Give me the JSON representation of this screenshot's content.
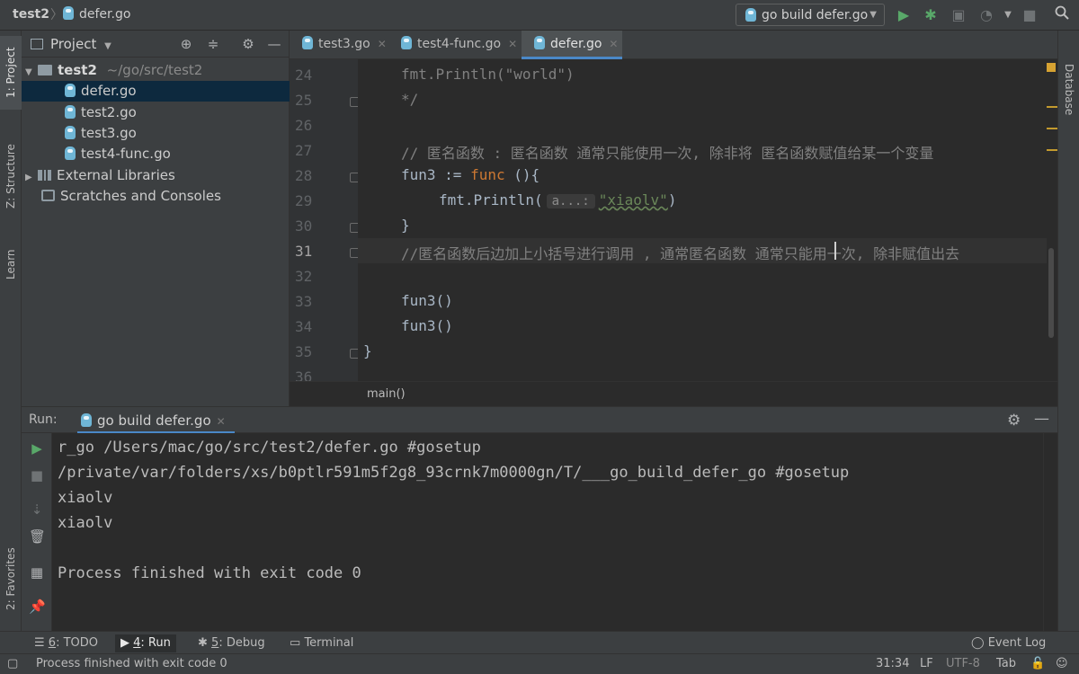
{
  "titlebar": {
    "project": "test2",
    "separator": "〉",
    "file": "defer.go"
  },
  "toolbar": {
    "run_config": "go build defer.go",
    "icons": [
      "run-icon",
      "debug-icon",
      "coverage-icon",
      "profile-icon",
      "stop-icon",
      "search-icon"
    ]
  },
  "left_strip": {
    "project": "1: Project",
    "structure": "Z: Structure",
    "learn": "Learn",
    "favorites": "2: Favorites"
  },
  "right_strip": {
    "database": "Database"
  },
  "project_panel": {
    "title": "Project",
    "root_name": "test2",
    "root_path": "~/go/src/test2",
    "files": [
      "defer.go",
      "test2.go",
      "test3.go",
      "test4-func.go"
    ],
    "selected_file": "defer.go",
    "external_libraries": "External Libraries",
    "scratches": "Scratches and Consoles"
  },
  "editor": {
    "tabs": [
      {
        "label": "test3.go",
        "active": false
      },
      {
        "label": "test4-func.go",
        "active": false
      },
      {
        "label": "defer.go",
        "active": true
      }
    ],
    "line_numbers": [
      "24",
      "25",
      "26",
      "27",
      "28",
      "29",
      "30",
      "31",
      "32",
      "33",
      "34",
      "35",
      "36"
    ],
    "current_line": "31",
    "code": {
      "l24": "fmt.Println(\"world\")",
      "l25": " */",
      "l27": "// 匿名函数 :   匿名函数 通常只能使用一次, 除非将 匿名函数赋值给某一个变量",
      "l28_a": "fun3 := ",
      "l28_kw": "func",
      "l28_b": " (){",
      "l29_a": "fmt.Println(",
      "l29_hint": "a...:",
      "l29_str": "\"xiaolv\"",
      "l29_b": ")",
      "l30": "}",
      "l31": "//匿名函数后边加上小括号进行调用 , 通常匿名函数 通常只能用一次, 除非赋值出去",
      "l33": "fun3()",
      "l34": "fun3()",
      "l35": "}"
    },
    "breadcrumb": "main()"
  },
  "run_panel": {
    "label": "Run:",
    "tab": "go build defer.go",
    "output": [
      "r_go /Users/mac/go/src/test2/defer.go #gosetup",
      "/private/var/folders/xs/b0ptlr591m5f2g8_93crnk7m0000gn/T/___go_build_defer_go #gosetup",
      "xiaolv",
      "xiaolv",
      "",
      "Process finished with exit code 0"
    ]
  },
  "bottom_tools": {
    "todo_num": "6",
    "todo": ": TODO",
    "run_num": "4",
    "run": ": Run",
    "debug_num": "5",
    "debug": ": Debug",
    "terminal": "Terminal",
    "event_log": "Event Log"
  },
  "status_bar": {
    "message": "Process finished with exit code 0",
    "position": "31:34",
    "line_sep": "LF",
    "encoding": "UTF-8",
    "indent": "Tab"
  },
  "colors": {
    "accent": "#4a88c7",
    "run_green": "#59a869",
    "keyword": "#cc7832",
    "string": "#6a8759",
    "comment": "#808080"
  }
}
